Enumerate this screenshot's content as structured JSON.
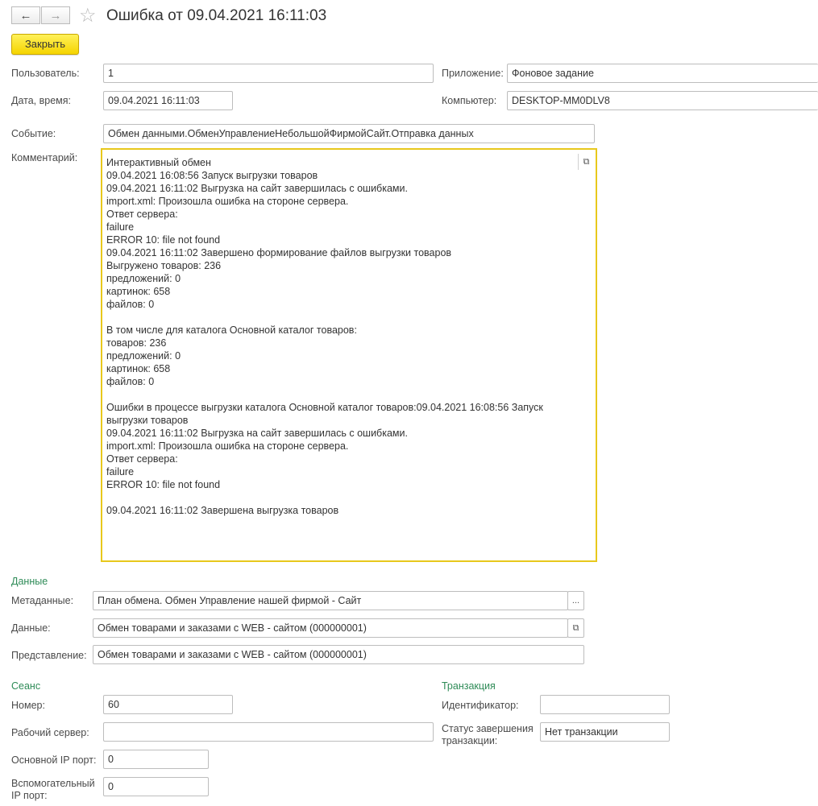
{
  "window": {
    "title": "Ошибка от 09.04.2021 16:11:03"
  },
  "toolbar": {
    "close_label": "Закрыть"
  },
  "nav": {
    "back": "←",
    "forward": "→",
    "star": "☆"
  },
  "fields": {
    "user": {
      "label": "Пользователь:",
      "value": "1"
    },
    "application": {
      "label": "Приложение:",
      "value": "Фоновое задание"
    },
    "datetime": {
      "label": "Дата, время:",
      "value": "09.04.2021 16:11:03"
    },
    "computer": {
      "label": "Компьютер:",
      "value": "DESKTOP-MM0DLV8"
    },
    "event": {
      "label": "Событие:",
      "value": "Обмен данными.ОбменУправлениеНебольшойФирмойСайт.Отправка данных"
    },
    "comment": {
      "label": "Комментарий:",
      "text": "Интерактивный обмен\n09.04.2021 16:08:56 Запуск выгрузки товаров\n09.04.2021 16:11:02 Выгрузка на сайт завершилась с ошибками.\nimport.xml: Произошла ошибка на стороне сервера.\nОтвет сервера:\nfailure\nERROR 10: file not found\n09.04.2021 16:11:02 Завершено формирование файлов выгрузки товаров\nВыгружено товаров: 236\nпредложений: 0\nкартинок: 658\nфайлов: 0\n\nВ том числе для каталога Основной каталог товаров:\nтоваров: 236\nпредложений: 0\nкартинок: 658\nфайлов: 0\n\nОшибки в процессе выгрузки каталога Основной каталог товаров:09.04.2021 16:08:56 Запуск выгрузки товаров\n09.04.2021 16:11:02 Выгрузка на сайт завершилась с ошибками.\nimport.xml: Произошла ошибка на стороне сервера.\nОтвет сервера:\nfailure\nERROR 10: file not found\n\n09.04.2021 16:11:02 Завершена выгрузка товаров"
    }
  },
  "data_section": {
    "title": "Данные",
    "metadata": {
      "label": "Метаданные:",
      "value": "План обмена. Обмен Управление нашей фирмой - Сайт"
    },
    "data": {
      "label": "Данные:",
      "value": "Обмен товарами и заказами с WEB - сайтом (000000001)"
    },
    "presentation": {
      "label": "Представление:",
      "value": "Обмен товарами и заказами с WEB - сайтом (000000001)"
    }
  },
  "session_section": {
    "title": "Сеанс",
    "number": {
      "label": "Номер:",
      "value": "60"
    },
    "work_server": {
      "label": "Рабочий сервер:",
      "value": ""
    },
    "main_ip_port": {
      "label": "Основной IP порт:",
      "value": "0"
    },
    "aux_ip_port": {
      "label_line1": "Вспомогательный",
      "label_line2": "IP порт:",
      "value": "0"
    }
  },
  "transaction_section": {
    "title": "Транзакция",
    "identifier": {
      "label": "Идентификатор:",
      "value": ""
    },
    "status": {
      "label_line1": "Статус завершения",
      "label_line2": "транзакции:",
      "value": "Нет транзакции"
    }
  },
  "icons": {
    "open": "⧉",
    "ellipsis": "..."
  },
  "colors": {
    "accent_yellow": "#f5d400",
    "focus_border": "#e8c81c",
    "section_green": "#2e8b57"
  }
}
